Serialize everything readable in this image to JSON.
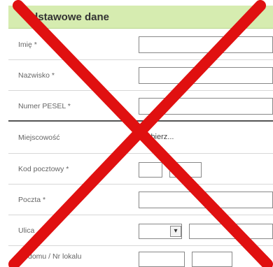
{
  "section": {
    "title": "odstawowe dane"
  },
  "rows": [
    {
      "label": "Imię *"
    },
    {
      "label": "Nazwisko *"
    },
    {
      "label": "Numer PESEL *"
    },
    {
      "label": "Miejscowość",
      "value": "wybierz..."
    },
    {
      "label": "Kod pocztowy *"
    },
    {
      "label": "Poczta *"
    },
    {
      "label": "Ulica"
    },
    {
      "label": "Nr domu / Nr lokalu"
    }
  ],
  "overlay": {
    "color": "#e01010"
  }
}
